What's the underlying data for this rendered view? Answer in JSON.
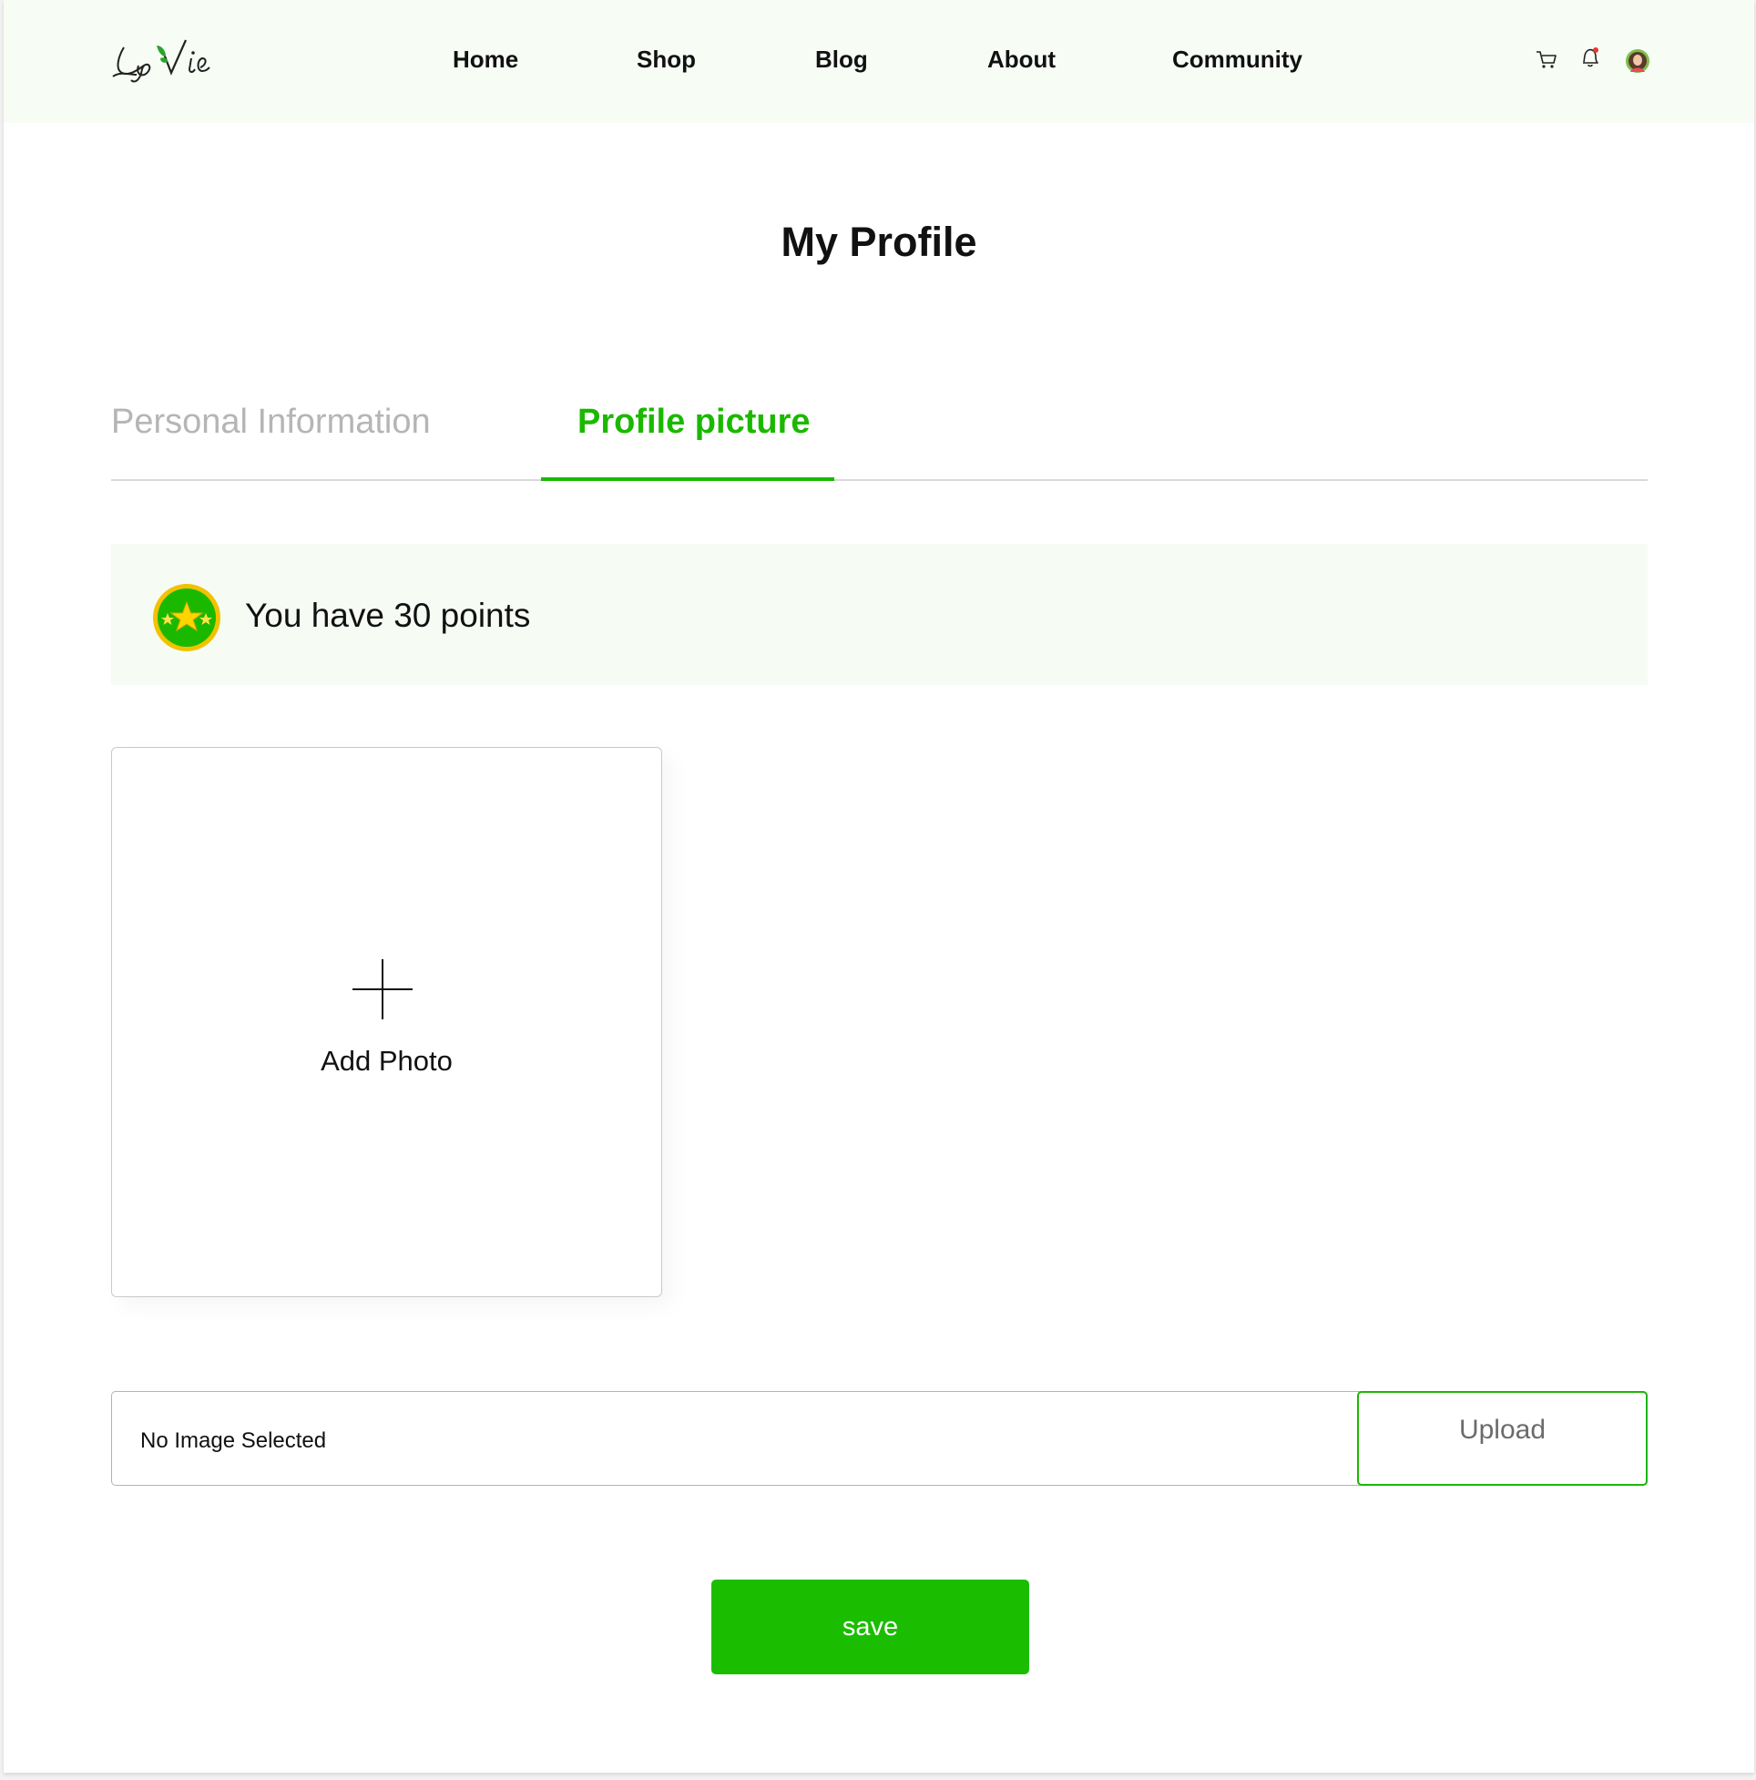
{
  "header": {
    "logo_text": "La Vie",
    "nav": [
      {
        "label": "Home"
      },
      {
        "label": "Shop"
      },
      {
        "label": "Blog"
      },
      {
        "label": "About"
      },
      {
        "label": "Community"
      }
    ],
    "icons": [
      "cart-icon",
      "bell-icon",
      "avatar"
    ]
  },
  "page": {
    "title": "My Profile"
  },
  "tabs": [
    {
      "label": "Personal Information",
      "active": false
    },
    {
      "label": "Profile picture",
      "active": true
    }
  ],
  "points": {
    "text": "You have 30 points",
    "badge_icon": "stars-badge-icon"
  },
  "photo": {
    "add_label": "Add Photo",
    "icon": "plus-icon"
  },
  "upload": {
    "file_status": "No Image Selected",
    "button_label": "Upload"
  },
  "actions": {
    "save_label": "save"
  },
  "colors": {
    "accent": "#1bb800",
    "nav_background": "#f7fcf5",
    "banner_background": "#f6fbf4",
    "inactive_tab": "#b5b5b5",
    "badge_ring": "#f2c200"
  }
}
